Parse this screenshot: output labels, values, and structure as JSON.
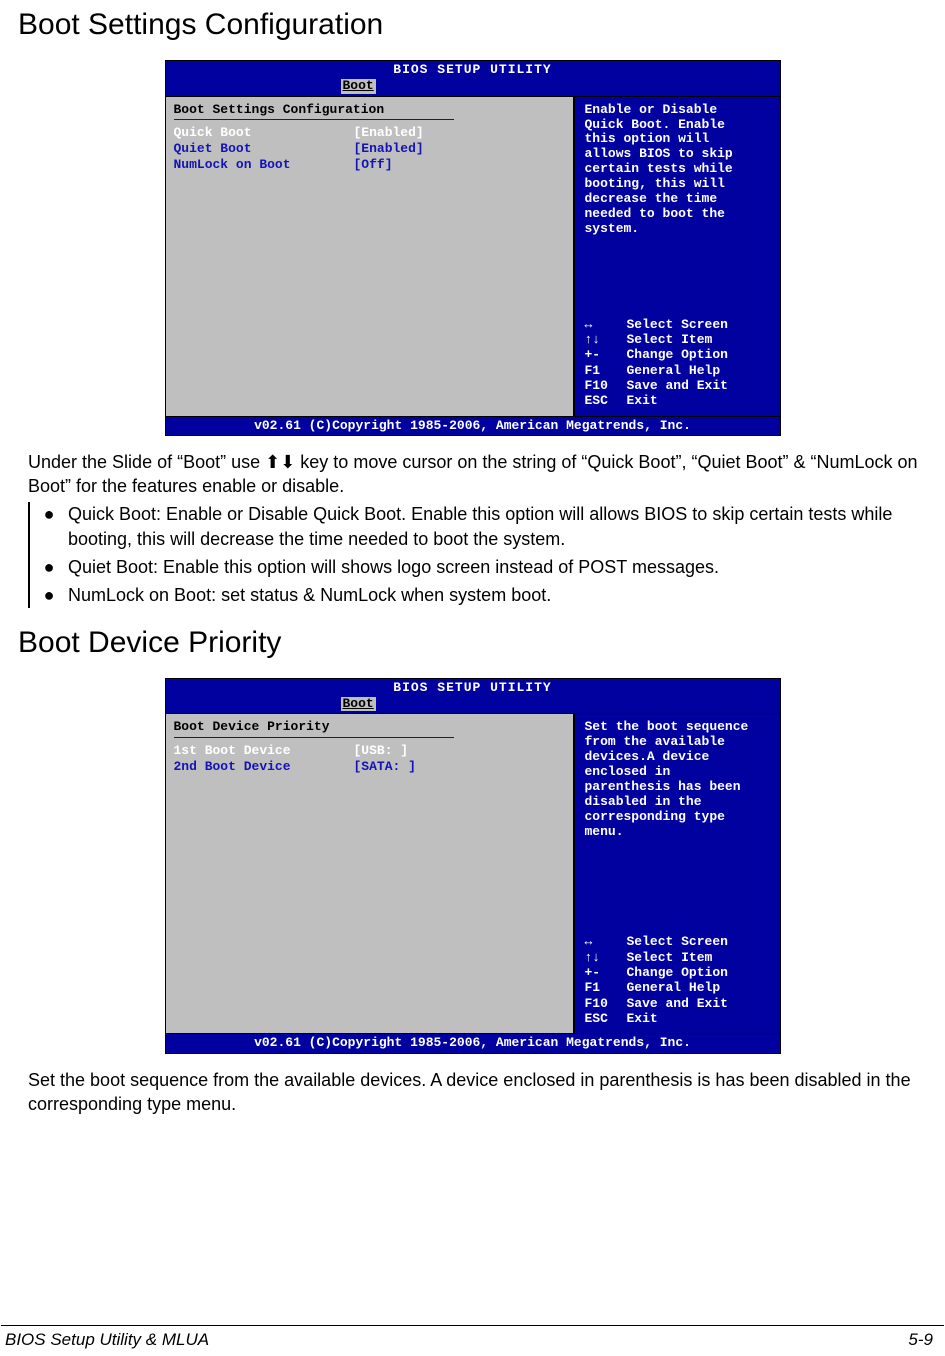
{
  "section1": {
    "heading": "Boot Settings Configuration",
    "bios": {
      "title": "BIOS SETUP UTILITY",
      "tab": "Boot",
      "left_title": "Boot Settings Configuration",
      "options": [
        {
          "label": "Quick Boot",
          "value": "[Enabled]",
          "selected": true
        },
        {
          "label": "Quiet Boot",
          "value": "[Enabled]",
          "selected": false
        },
        {
          "label": "NumLock on Boot",
          "value": "[Off]",
          "selected": false
        }
      ],
      "help": "Enable or Disable\nQuick Boot. Enable\nthis option will\nallows BIOS to skip\ncertain tests while\nbooting, this will\ndecrease the time\nneeded to boot the\nsystem.",
      "nav": [
        {
          "key": "↔",
          "desc": "Select Screen"
        },
        {
          "key": "↑↓",
          "desc": "Select Item"
        },
        {
          "key": "+-",
          "desc": "Change Option"
        },
        {
          "key": "F1",
          "desc": "General Help"
        },
        {
          "key": "F10",
          "desc": "Save and Exit"
        },
        {
          "key": "ESC",
          "desc": "Exit"
        }
      ],
      "footer": "v02.61 (C)Copyright 1985-2006, American Megatrends, Inc."
    },
    "para": "Under the Slide of “Boot” use ⬆⬇ key to move cursor on the string of “Quick Boot”, “Quiet Boot” & “NumLock on Boot” for the features enable or disable.",
    "bullets": [
      "Quick Boot: Enable or Disable Quick Boot. Enable this option will allows BIOS to skip certain tests while booting, this will decrease the time needed to boot the system.",
      "Quiet Boot: Enable this option will shows logo screen instead of POST messages.",
      "NumLock on Boot: set status & NumLock when system boot."
    ]
  },
  "section2": {
    "heading": "Boot Device Priority",
    "bios": {
      "title": "BIOS SETUP UTILITY",
      "tab": "Boot",
      "left_title": "Boot Device Priority",
      "options": [
        {
          "label": "1st Boot Device",
          "value": "[USB:           ]",
          "selected": true
        },
        {
          "label": "2nd Boot Device",
          "value": "[SATA:          ]",
          "selected": false
        }
      ],
      "help": "Set the boot sequence\nfrom the available\ndevices.A device\nenclosed in\nparenthesis has been\ndisabled in the\ncorresponding type\nmenu.",
      "nav": [
        {
          "key": "↔",
          "desc": "Select Screen"
        },
        {
          "key": "↑↓",
          "desc": "Select Item"
        },
        {
          "key": "+-",
          "desc": "Change Option"
        },
        {
          "key": "F1",
          "desc": "General Help"
        },
        {
          "key": "F10",
          "desc": "Save and Exit"
        },
        {
          "key": "ESC",
          "desc": "Exit"
        }
      ],
      "footer": "v02.61 (C)Copyright 1985-2006, American Megatrends, Inc."
    },
    "para": "Set the boot sequence from the available devices. A device enclosed in parenthesis is has been disabled in the corresponding type menu."
  },
  "page_footer": {
    "left": "BIOS Setup Utility & MLUA",
    "right": "5-9"
  }
}
